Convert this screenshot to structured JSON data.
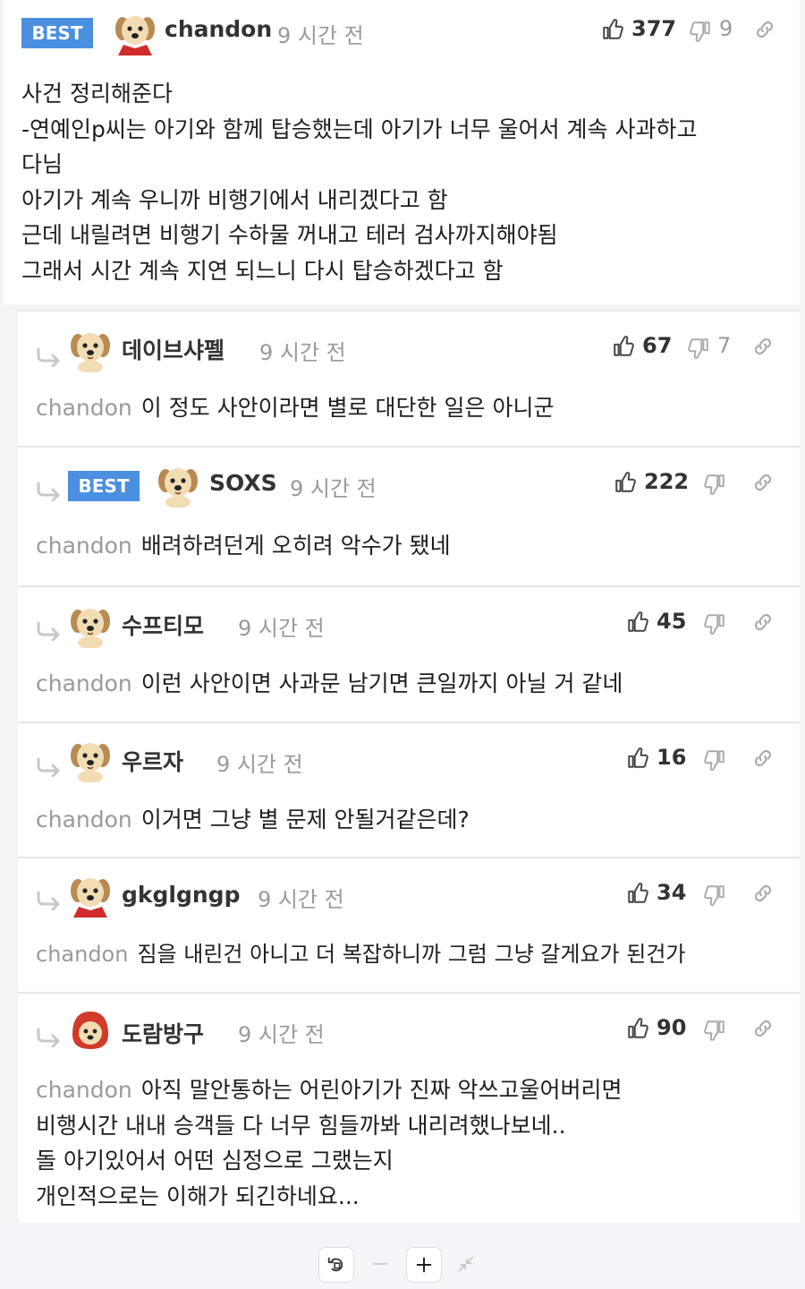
{
  "labels": {
    "best": "BEST"
  },
  "icons": {
    "like": "thumbs-up-icon",
    "dislike": "thumbs-down-icon",
    "link": "link-icon",
    "reply": "reply-arrow-icon",
    "avatar": "puppy-avatar-icon"
  },
  "colors": {
    "badge": "#4a8fe0",
    "muted": "#9a9a9a",
    "background": "#f3f4f6"
  },
  "main": {
    "nickname": "chandon",
    "time": "9 시간 전",
    "likes": "377",
    "dislikes": "9",
    "lines": [
      "사건 정리해준다",
      "-연예인p씨는 아기와 함께 탑승했는데 아기가 너무 울어서 계속 사과하고",
      "다님",
      "아기가 계속 우니까 비행기에서 내리겠다고 함",
      "근데 내릴려면 비행기 수하물 꺼내고 테러 검사까지해야됨",
      "그래서 시간 계속 지연 되느니 다시 탑승하겠다고 함"
    ]
  },
  "replies": [
    {
      "nickname": "데이브샤펠",
      "time": "9 시간 전",
      "likes": "67",
      "dislikes": "7",
      "mention": "chandon",
      "lines": [
        "이 정도 사안이라면 별로 대단한 일은 아니군"
      ]
    },
    {
      "nickname": "SOXS",
      "time": "9 시간 전",
      "likes": "222",
      "dislikes": "",
      "mention": "chandon",
      "lines": [
        "배려하려던게 오히려 악수가 됐네"
      ]
    },
    {
      "nickname": "수프티모",
      "time": "9 시간 전",
      "likes": "45",
      "dislikes": "",
      "mention": "chandon",
      "lines": [
        "이런 사안이면 사과문 남기면 큰일까지 아닐 거 같네"
      ]
    },
    {
      "nickname": "우르자",
      "time": "9 시간 전",
      "likes": "16",
      "dislikes": "",
      "mention": "chandon",
      "lines": [
        "이거면 그냥 별 문제 안될거같은데?"
      ]
    },
    {
      "nickname": "gkglgngp",
      "time": "9 시간 전",
      "likes": "34",
      "dislikes": "",
      "mention": "chandon",
      "lines": [
        "짐을 내린건 아니고 더 복잡하니까 그럼 그냥 갈게요가 된건가"
      ]
    },
    {
      "nickname": "도람방구",
      "time": "9 시간 전",
      "likes": "90",
      "dislikes": "",
      "mention": "chandon",
      "lines": [
        "아직 말안통하는 어린아기가 진짜 악쓰고울어버리면",
        "비행시간 내내 승객들 다 너무 힘들까봐 내리려했나보네..",
        "돌 아기있어서 어떤 심정으로 그랬는지",
        "개인적으로는 이해가 되긴하네요..."
      ]
    }
  ],
  "toolbar": {
    "buttons": [
      "rotate-icon",
      "zoom-out-icon",
      "zoom-in-icon",
      "collapse-icon"
    ]
  }
}
